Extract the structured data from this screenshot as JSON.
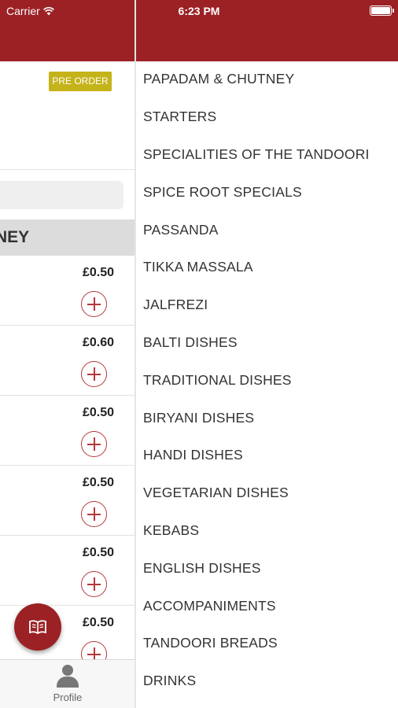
{
  "status_bar": {
    "carrier": "Carrier",
    "time": "6:23 PM"
  },
  "colors": {
    "brand_red": "#9b2125",
    "preorder_badge": "#c5b31a",
    "add_icon": "#b5373b"
  },
  "main": {
    "preorder_label": "PRE ORDER",
    "category_heading": "NEY",
    "items": [
      {
        "price": "£0.50"
      },
      {
        "price": "£0.60"
      },
      {
        "price": "£0.50"
      },
      {
        "price": "£0.50"
      },
      {
        "price": "£0.50"
      },
      {
        "price": "£0.50"
      }
    ]
  },
  "tabbar": {
    "profile_label": "Profile"
  },
  "side_menu": {
    "items": [
      {
        "label": "PAPADAM & CHUTNEY"
      },
      {
        "label": "STARTERS"
      },
      {
        "label": "SPECIALITIES OF THE TANDOORI"
      },
      {
        "label": "SPICE ROOT SPECIALS"
      },
      {
        "label": "PASSANDA"
      },
      {
        "label": "TIKKA MASSALA"
      },
      {
        "label": "JALFREZI"
      },
      {
        "label": "BALTI DISHES"
      },
      {
        "label": "TRADITIONAL DISHES"
      },
      {
        "label": "BIRYANI DISHES"
      },
      {
        "label": "HANDI DISHES"
      },
      {
        "label": "VEGETARIAN DISHES"
      },
      {
        "label": "KEBABS"
      },
      {
        "label": "ENGLISH DISHES"
      },
      {
        "label": "ACCOMPANIMENTS"
      },
      {
        "label": "TANDOORI BREADS"
      },
      {
        "label": "DRINKS"
      }
    ]
  }
}
